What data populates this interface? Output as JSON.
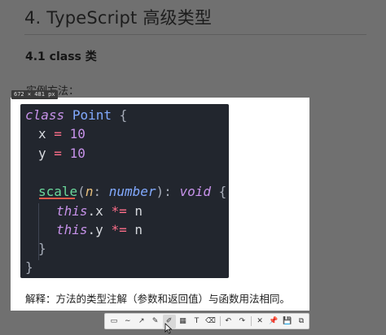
{
  "document": {
    "title": "4. TypeScript 高级类型",
    "section_heading": "4.1 class 类",
    "example_label": "实例方法："
  },
  "screenshot_tool": {
    "dimension_badge": "672 × 481 px",
    "tools": [
      {
        "name": "rectangle-icon",
        "glyph": "▭"
      },
      {
        "name": "freehand-icon",
        "glyph": "∼"
      },
      {
        "name": "arrow-icon",
        "glyph": "↗"
      },
      {
        "name": "pen-icon",
        "glyph": "✎"
      },
      {
        "name": "marker-icon",
        "glyph": "✐"
      },
      {
        "name": "mosaic-icon",
        "glyph": "▦"
      },
      {
        "name": "text-icon",
        "glyph": "T"
      },
      {
        "name": "eraser-icon",
        "glyph": "⌫"
      },
      {
        "name": "undo-icon",
        "glyph": "↶"
      },
      {
        "name": "redo-icon",
        "glyph": "↷"
      },
      {
        "name": "cancel-icon",
        "glyph": "✕"
      },
      {
        "name": "pin-icon",
        "glyph": "📌"
      },
      {
        "name": "save-icon",
        "glyph": "💾"
      },
      {
        "name": "copy-icon",
        "glyph": "⧉"
      }
    ]
  },
  "code": {
    "kw_class": "class",
    "class_name": "Point",
    "open_brace": "{",
    "x_prop": "x",
    "y_prop": "y",
    "eq": "=",
    "x_val": "10",
    "y_val": "10",
    "method": "scale",
    "param": "n",
    "colon": ":",
    "param_type": "number",
    "ret_type": "void",
    "this_kw": "this",
    "x_member": ".x",
    "y_member": ".y",
    "op": "*=",
    "rhs": "n",
    "close_inner": "}",
    "close_outer": "}"
  },
  "note": "解释：方法的类型注解（参数和返回值）与函数用法相同。"
}
